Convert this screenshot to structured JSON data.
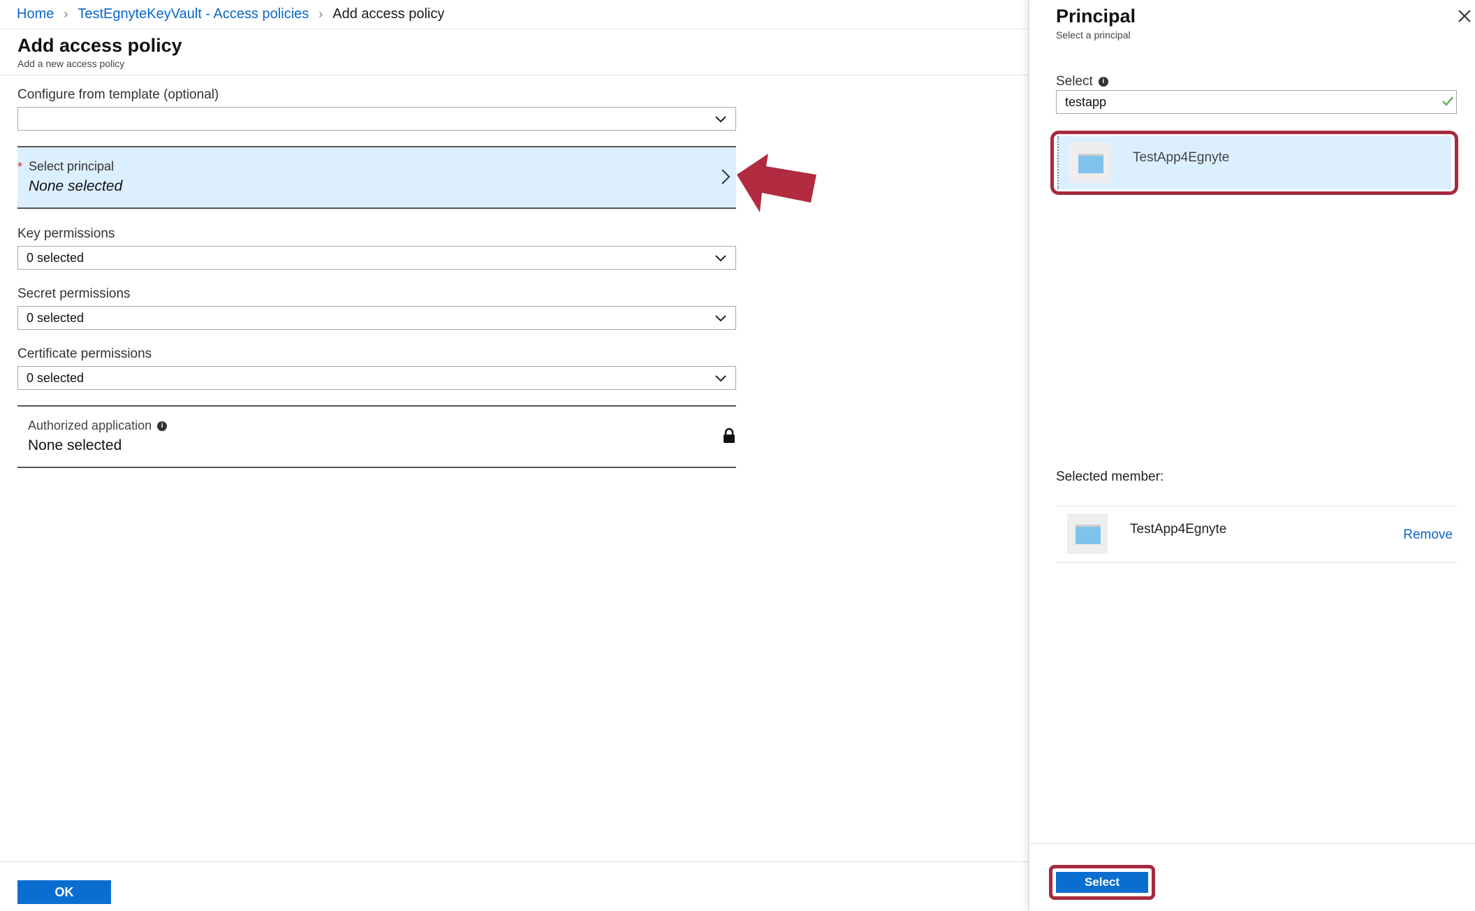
{
  "breadcrumb": {
    "home": "Home",
    "vault": "TestEgnyteKeyVault - Access policies",
    "current": "Add access policy"
  },
  "header": {
    "title": "Add access policy",
    "subtitle": "Add a new access policy"
  },
  "form": {
    "template_label": "Configure from template (optional)",
    "template_value": "",
    "principal_label": "Select principal",
    "principal_value": "None selected",
    "key_label": "Key permissions",
    "key_value": "0 selected",
    "secret_label": "Secret permissions",
    "secret_value": "0 selected",
    "cert_label": "Certificate permissions",
    "cert_value": "0 selected",
    "authorized_label": "Authorized application",
    "authorized_value": "None selected",
    "ok_label": "OK"
  },
  "panel": {
    "title": "Principal",
    "subtitle": "Select a principal",
    "select_label": "Select",
    "search_value": "testapp",
    "result_name": "TestApp4Egnyte",
    "selected_member_label": "Selected member:",
    "member_name": "TestApp4Egnyte",
    "remove_label": "Remove",
    "select_button": "Select"
  },
  "colors": {
    "accent": "#0a6ed1",
    "highlight": "#a52a3f",
    "selected_bg": "#dcefff"
  }
}
